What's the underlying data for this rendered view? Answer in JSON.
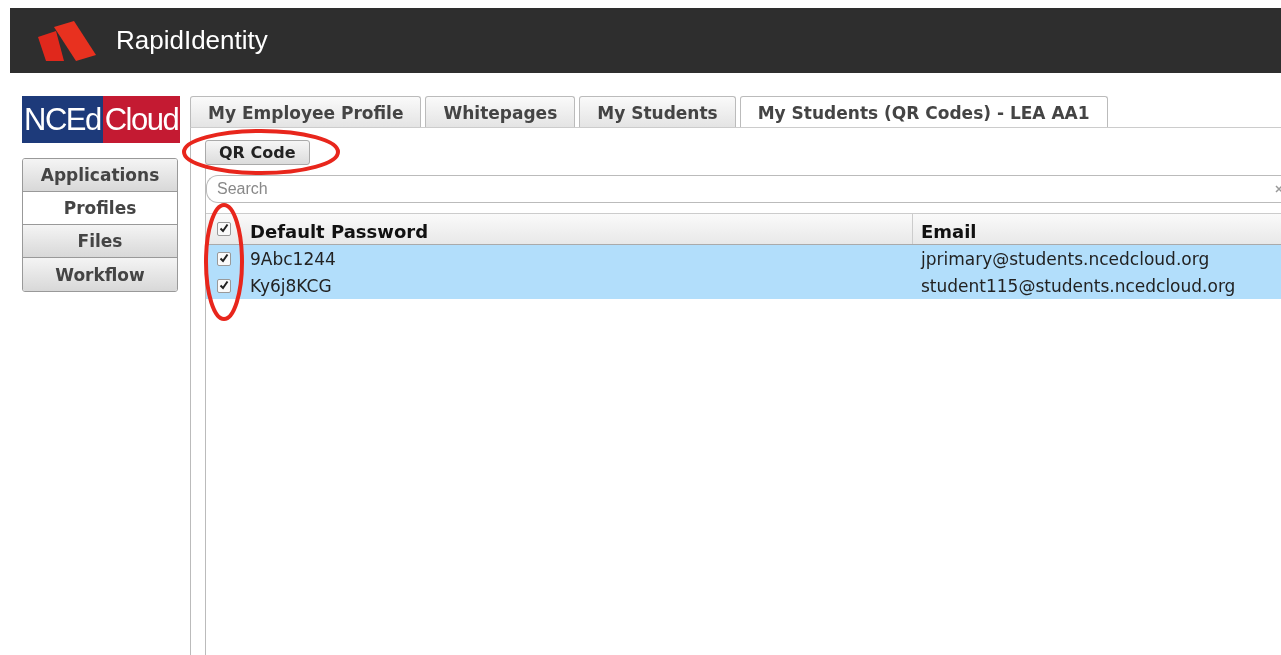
{
  "header": {
    "title": "RapidIdentity"
  },
  "logo": {
    "part_1": "NCEd",
    "part_2": "Cloud"
  },
  "sidebar": {
    "items": [
      {
        "label": "Applications",
        "selected": false
      },
      {
        "label": "Profiles",
        "selected": true
      },
      {
        "label": "Files",
        "selected": false
      },
      {
        "label": "Workflow",
        "selected": false
      }
    ]
  },
  "tabs": [
    {
      "label": "My Employee Profile",
      "selected": false
    },
    {
      "label": "Whitepages",
      "selected": false
    },
    {
      "label": "My Students",
      "selected": false
    },
    {
      "label": "My Students (QR Codes) - LEA AA1",
      "selected": true
    }
  ],
  "toolbar": {
    "button": "QR Code"
  },
  "search": {
    "placeholder": "Search"
  },
  "table": {
    "select_all_checked": true,
    "columns": [
      "Default Password",
      "Email"
    ],
    "rows": [
      {
        "checked": true,
        "selected": true,
        "cells": [
          "9Abc1244",
          "jprimary@students.ncedcloud.org"
        ]
      },
      {
        "checked": true,
        "selected": true,
        "cells": [
          "Ky6j8KCG",
          "student115@students.ncedcloud.org"
        ]
      }
    ]
  }
}
